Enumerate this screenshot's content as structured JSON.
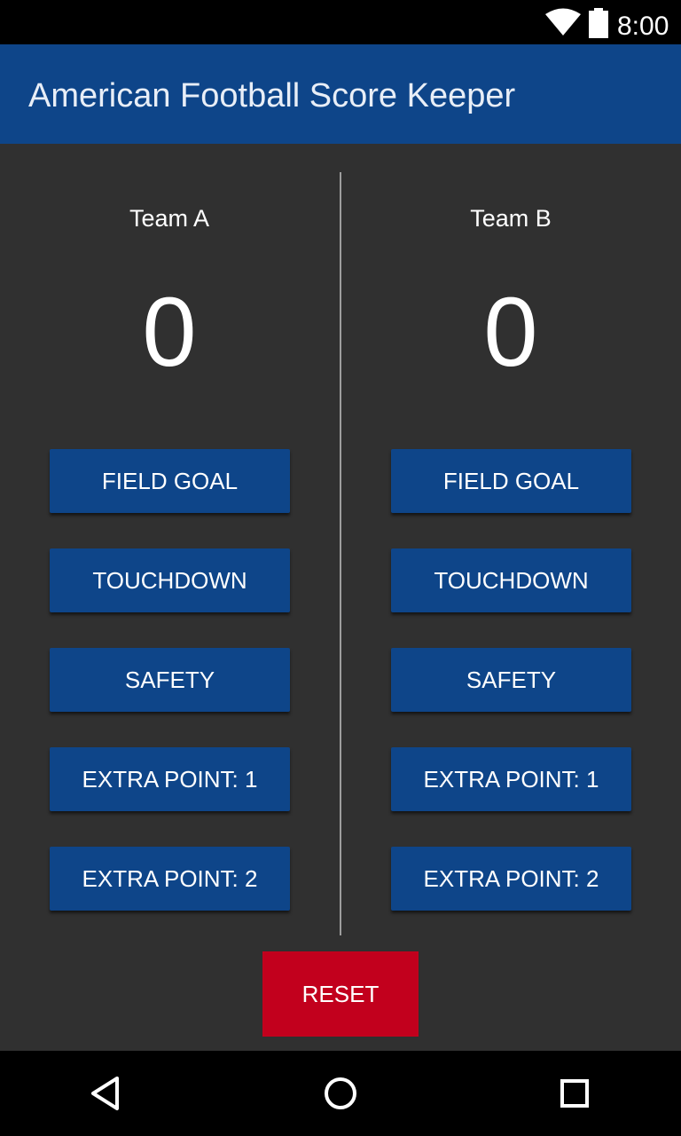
{
  "status_bar": {
    "time": "8:00",
    "icons": [
      "wifi-icon",
      "battery-icon"
    ]
  },
  "app_bar": {
    "title": "American Football Score Keeper"
  },
  "teams": [
    {
      "name": "Team A",
      "score": "0",
      "buttons": [
        "FIELD GOAL",
        "TOUCHDOWN",
        "SAFETY",
        "EXTRA POINT: 1",
        "EXTRA POINT: 2"
      ]
    },
    {
      "name": "Team B",
      "score": "0",
      "buttons": [
        "FIELD GOAL",
        "TOUCHDOWN",
        "SAFETY",
        "EXTRA POINT: 1",
        "EXTRA POINT: 2"
      ]
    }
  ],
  "reset": {
    "label": "RESET"
  },
  "navigation": {
    "icons": [
      "back-icon",
      "home-icon",
      "recents-icon"
    ]
  },
  "colors": {
    "app_bar": "#0e4589",
    "background": "#303030",
    "button": "#0e4589",
    "reset": "#c2001d",
    "text": "#ffffff"
  }
}
